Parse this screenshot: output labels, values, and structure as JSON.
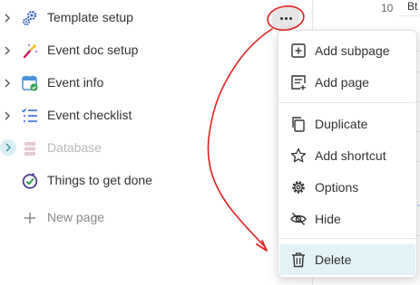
{
  "sidebar": {
    "items": [
      {
        "label": "Template setup",
        "icon": "gears-icon"
      },
      {
        "label": "Event doc setup",
        "icon": "magic-wand-icon"
      },
      {
        "label": "Event info",
        "icon": "calendar-check-icon"
      },
      {
        "label": "Event checklist",
        "icon": "checklist-icon"
      },
      {
        "label": "Database",
        "icon": "database-icon"
      },
      {
        "label": "Things to get done",
        "icon": "check-circle-icon"
      }
    ],
    "new_page": "New page"
  },
  "background": {
    "row_number": "10",
    "header_text": "Bt"
  },
  "context_menu": {
    "items": [
      {
        "label": "Add subpage",
        "icon": "add-subpage-icon"
      },
      {
        "label": "Add page",
        "icon": "add-page-icon"
      },
      {
        "label": "Duplicate",
        "icon": "duplicate-icon"
      },
      {
        "label": "Add shortcut",
        "icon": "star-icon"
      },
      {
        "label": "Options",
        "icon": "gear-icon"
      },
      {
        "label": "Hide",
        "icon": "eye-off-icon"
      },
      {
        "label": "Delete",
        "icon": "trash-icon",
        "highlighted": true
      }
    ]
  },
  "colors": {
    "highlight": "#e3f2f6",
    "annotation": "#e02020",
    "accent_blue": "#2f6fd6"
  }
}
